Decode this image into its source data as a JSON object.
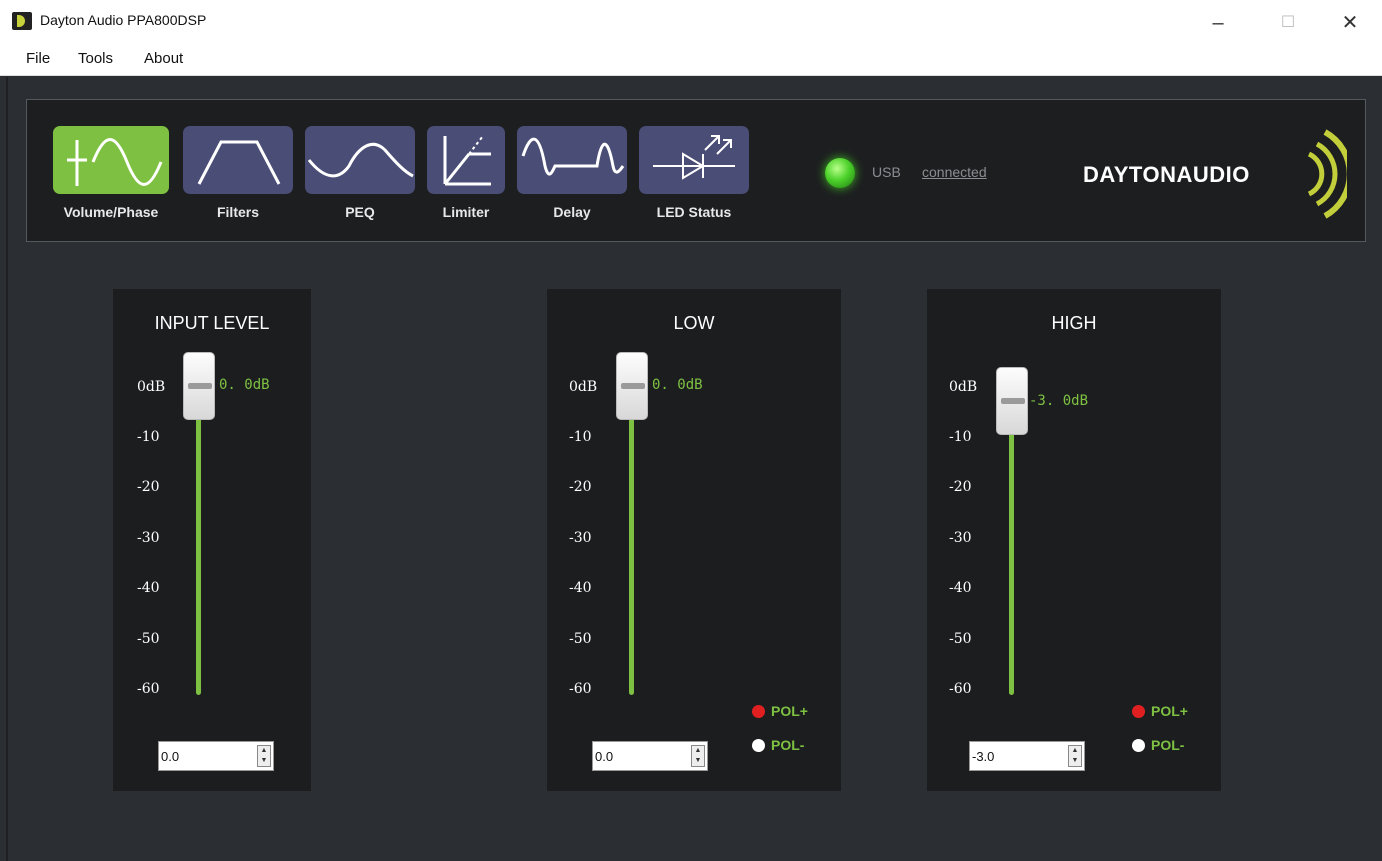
{
  "window": {
    "title": "Dayton Audio PPA800DSP",
    "minimize": "–",
    "maximize": "☐",
    "close": "✕"
  },
  "menu": [
    "File",
    "Tools",
    "About"
  ],
  "toolbar": {
    "tools": [
      {
        "label": "Volume/Phase",
        "icon": "volume-phase-icon",
        "active": true
      },
      {
        "label": "Filters",
        "icon": "filters-icon",
        "active": false
      },
      {
        "label": "PEQ",
        "icon": "peq-icon",
        "active": false
      },
      {
        "label": "Limiter",
        "icon": "limiter-icon",
        "active": false
      },
      {
        "label": "Delay",
        "icon": "delay-icon",
        "active": false
      },
      {
        "label": "LED Status",
        "icon": "led-status-icon",
        "active": false
      }
    ],
    "usb_label": "USB",
    "usb_status": "connected",
    "logo_text": "DAYTONAUDIO"
  },
  "colors": {
    "accent": "#7ec142",
    "tool_bg": "#4a4d75",
    "panel_bg": "#1c1d1f",
    "pol_plus": "#e02020",
    "pol_minus": "#ffffff"
  },
  "scale": [
    "0dB",
    "-10",
    "-20",
    "-30",
    "-40",
    "-50",
    "-60"
  ],
  "channels": {
    "input": {
      "title": "INPUT LEVEL",
      "readout": "0. 0dB",
      "value": "0.0",
      "level_db": 0.0
    },
    "low": {
      "title": "LOW",
      "readout": "0. 0dB",
      "value": "0.0",
      "level_db": 0.0,
      "pol_plus": "POL+",
      "pol_minus": "POL-"
    },
    "high": {
      "title": "HIGH",
      "readout": "-3. 0dB",
      "value": "-3.0",
      "level_db": -3.0,
      "pol_plus": "POL+",
      "pol_minus": "POL-"
    }
  }
}
